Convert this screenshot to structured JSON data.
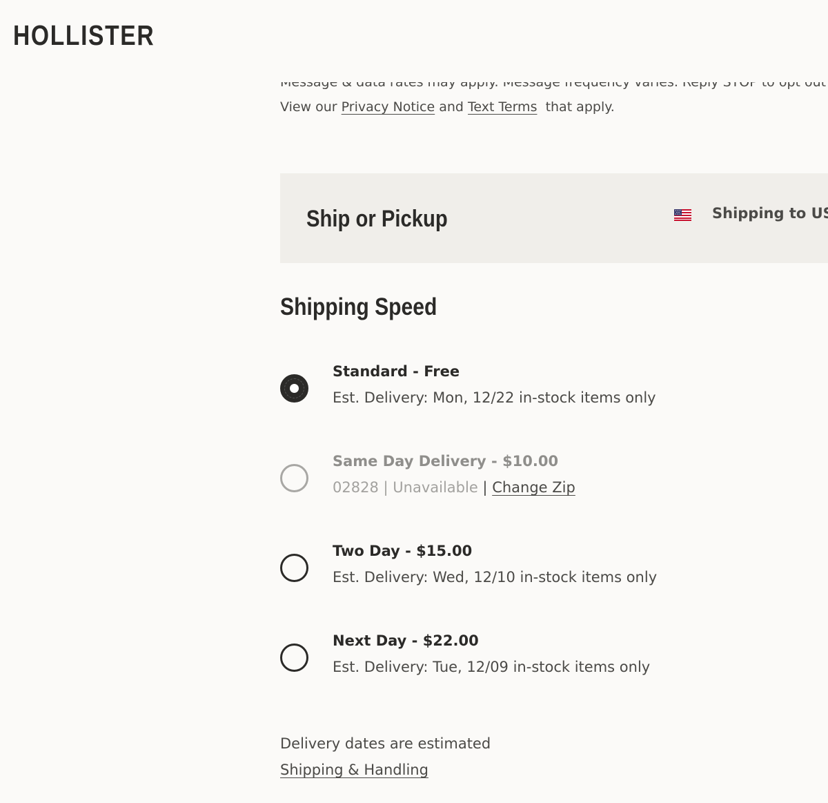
{
  "brand": {
    "logo": "HOLLISTER"
  },
  "sms_disclaimer": {
    "line1": "Message & data rates may apply. Message frequency varies. Reply STOP to opt out of these",
    "line2_prefix": "View our",
    "privacy_link": "Privacy Notice",
    "and": "and",
    "terms_link": "Text Terms",
    "line2_suffix": "that apply."
  },
  "ship_or_pickup": {
    "title": "Ship or Pickup",
    "flag_icon": "us-flag-icon",
    "shipping_to": "Shipping to US"
  },
  "shipping_speed": {
    "title": "Shipping Speed",
    "options": [
      {
        "title": "Standard - Free",
        "subtitle": "Est. Delivery: Mon, 12/22 in-stock items only",
        "selected": true,
        "disabled": false
      },
      {
        "title": "Same Day Delivery - $10.00",
        "zip": "02828",
        "status": "Unavailable",
        "separator": "|",
        "change_zip": "Change Zip",
        "selected": false,
        "disabled": true
      },
      {
        "title": "Two Day - $15.00",
        "subtitle": "Est. Delivery: Wed, 12/10 in-stock items only",
        "selected": false,
        "disabled": false
      },
      {
        "title": "Next Day - $22.00",
        "subtitle": "Est. Delivery: Tue, 12/09 in-stock items only",
        "selected": false,
        "disabled": false
      }
    ]
  },
  "footer": {
    "note": "Delivery dates are estimated",
    "link": "Shipping & Handling"
  },
  "colors": {
    "background": "#fbfaf8",
    "panel": "#f0eeea",
    "text": "#2b2a28",
    "muted": "#a3a29f"
  }
}
